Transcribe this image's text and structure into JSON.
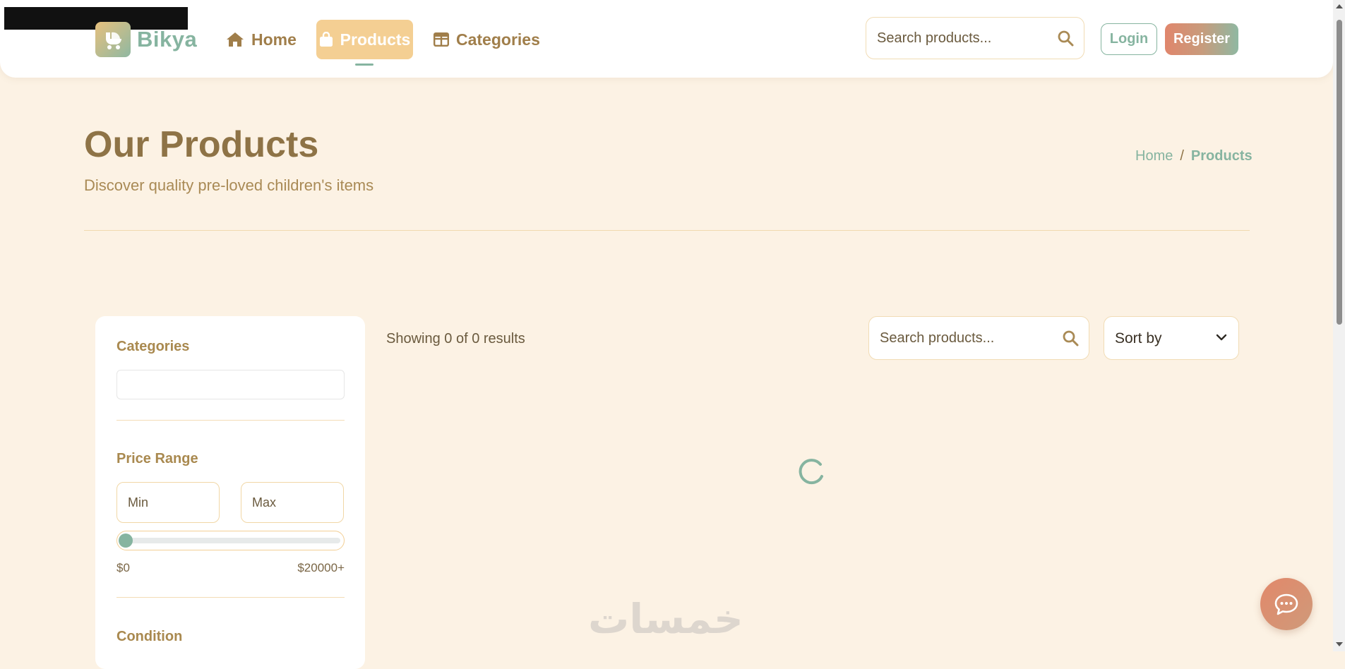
{
  "header": {
    "logo_text": "Bikya",
    "nav": {
      "home": "Home",
      "products": "Products",
      "categories": "Categories"
    },
    "search_placeholder": "Search products...",
    "login": "Login",
    "register": "Register"
  },
  "page": {
    "title": "Our Products",
    "subtitle": "Discover quality pre-loved children's items",
    "breadcrumb": {
      "home": "Home",
      "separator": "/",
      "current": "Products"
    }
  },
  "filters": {
    "categories_heading": "Categories",
    "price_heading": "Price Range",
    "min_placeholder": "Min",
    "max_placeholder": "Max",
    "price_min_label": "$0",
    "price_max_label": "$20000+",
    "price_slider_value": 0,
    "condition_heading": "Condition"
  },
  "toolbar": {
    "results_text": "Showing 0 of 0 results",
    "search_placeholder": "Search products...",
    "sort_label": "Sort by"
  },
  "watermark": "خمسات",
  "colors": {
    "primary_green": "#86b4a0",
    "accent_orange": "#f4cf93",
    "brown_text": "#8e7346",
    "background": "#fcf2e4",
    "register_gradient_start": "#e0866c"
  },
  "icons": [
    "stroller-icon",
    "home-icon",
    "shopping-bag-icon",
    "grid-icon",
    "search-icon",
    "chevron-down-icon",
    "spinner-icon",
    "chat-icon"
  ]
}
